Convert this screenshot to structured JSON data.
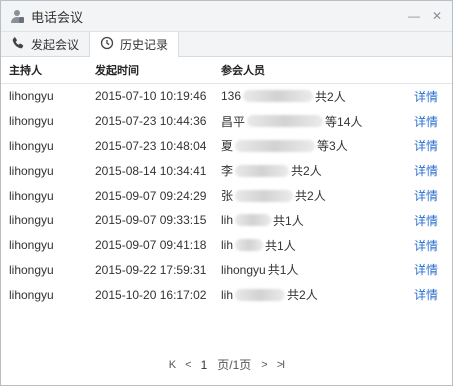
{
  "window": {
    "title": "电话会议",
    "minimize": "—",
    "close": "✕"
  },
  "tabs": [
    {
      "label": "发起会议",
      "icon": "phone-icon"
    },
    {
      "label": "历史记录",
      "icon": "clock-icon"
    }
  ],
  "table": {
    "headers": [
      "主持人",
      "发起时间",
      "参会人员"
    ],
    "rows": [
      {
        "host": "lihongyu",
        "time": "2015-07-10 10:19:46",
        "p_start": "136",
        "p_end": "共2人",
        "detail": "详情"
      },
      {
        "host": "lihongyu",
        "time": "2015-07-23 10:44:36",
        "p_start": "昌平",
        "p_end": "等14人",
        "detail": "详情"
      },
      {
        "host": "lihongyu",
        "time": "2015-07-23 10:48:04",
        "p_start": "夏",
        "p_end": "等3人",
        "detail": "详情"
      },
      {
        "host": "lihongyu",
        "time": "2015-08-14 10:34:41",
        "p_start": "李",
        "p_end": "共2人",
        "detail": "详情"
      },
      {
        "host": "lihongyu",
        "time": "2015-09-07 09:24:29",
        "p_start": "张",
        "p_end": "共2人",
        "detail": "详情"
      },
      {
        "host": "lihongyu",
        "time": "2015-09-07 09:33:15",
        "p_start": "lih",
        "p_end": "共1人",
        "detail": "详情"
      },
      {
        "host": "lihongyu",
        "time": "2015-09-07 09:41:18",
        "p_start": "lih",
        "p_end": "共1人",
        "detail": "详情"
      },
      {
        "host": "lihongyu",
        "time": "2015-09-22 17:59:31",
        "p_start": "lihongyu",
        "p_end": "共1人",
        "detail": "详情"
      },
      {
        "host": "lihongyu",
        "time": "2015-10-20 16:17:02",
        "p_start": "lih",
        "p_end": "共2人",
        "detail": "详情"
      }
    ]
  },
  "pager": {
    "first": "K",
    "prev": "<",
    "current": "1",
    "total": "页/1页",
    "next": ">",
    "last": ">I"
  }
}
